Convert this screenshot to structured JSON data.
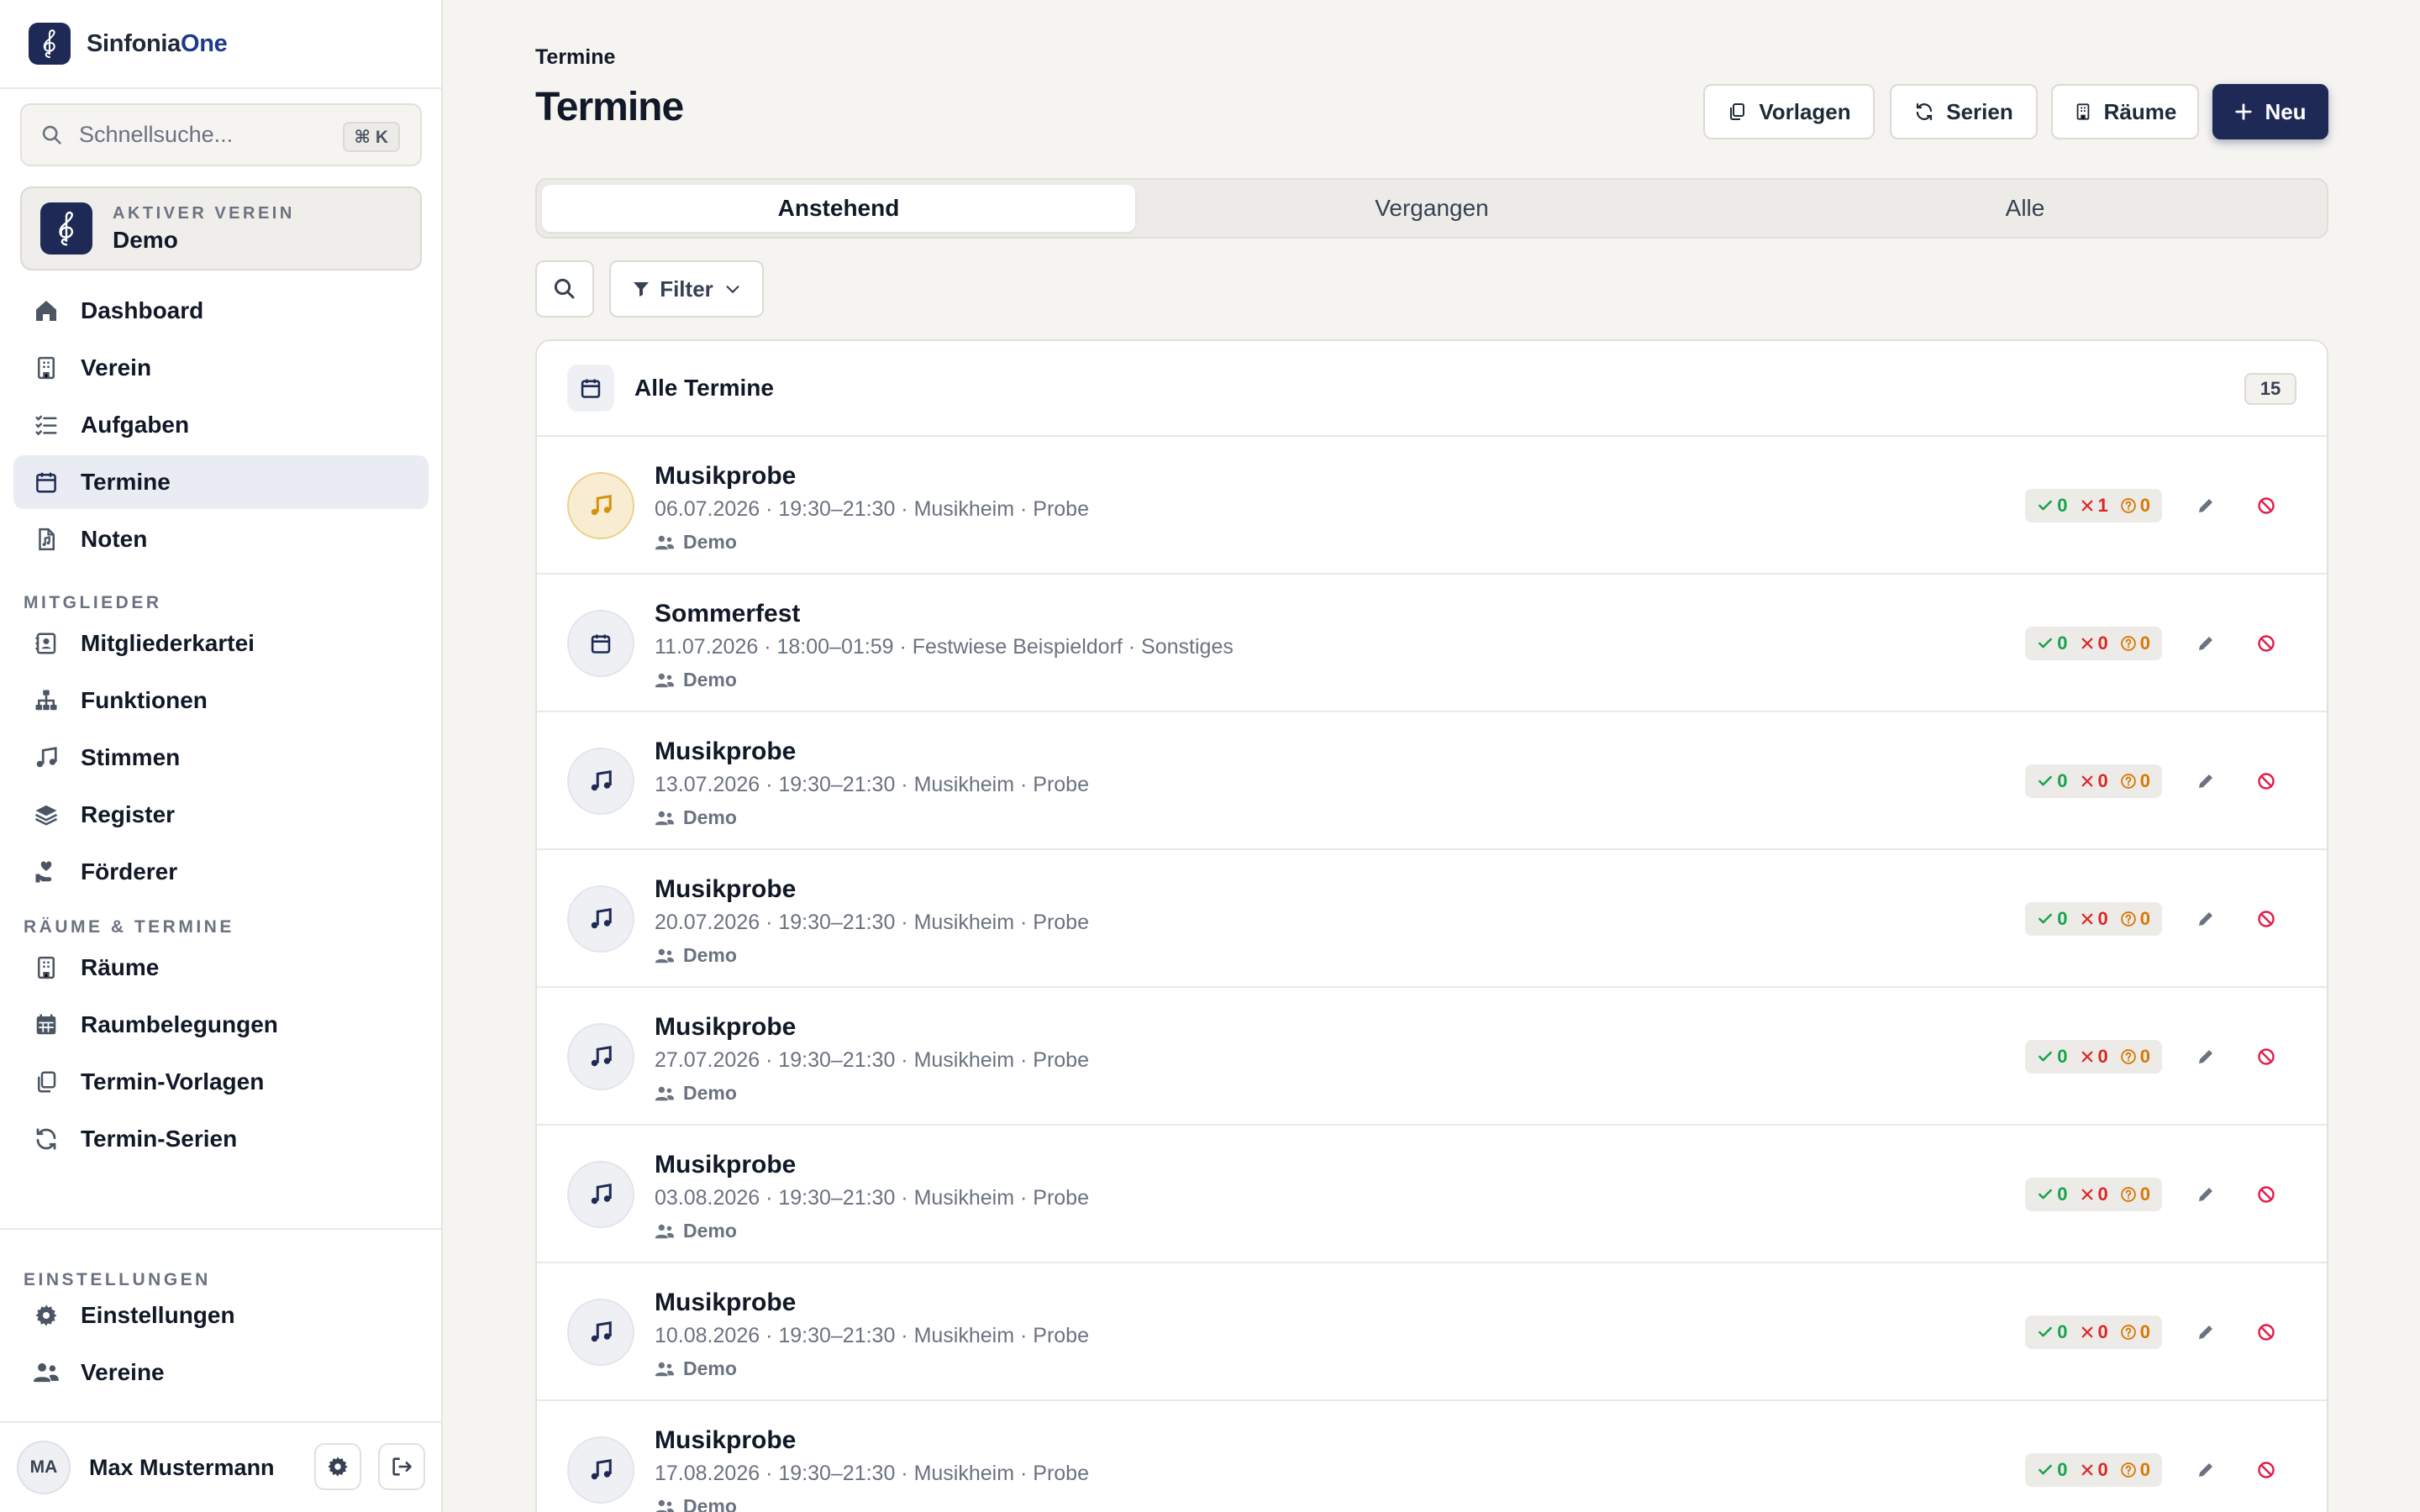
{
  "app": {
    "name_part1": "Sinfonia",
    "name_part2": "One"
  },
  "sidebar": {
    "search": {
      "placeholder": "Schnellsuche...",
      "shortcut": "⌘ K"
    },
    "club": {
      "caption": "AKTIVER VEREIN",
      "name": "Demo"
    },
    "items_main": [
      {
        "label": "Dashboard",
        "icon": "home-icon"
      },
      {
        "label": "Verein",
        "icon": "building-icon"
      },
      {
        "label": "Aufgaben",
        "icon": "tasks-icon"
      },
      {
        "label": "Termine",
        "icon": "calendar-icon",
        "active": true
      },
      {
        "label": "Noten",
        "icon": "sheet-music-file-icon"
      }
    ],
    "section_members": "MITGLIEDER",
    "items_members": [
      {
        "label": "Mitgliederkartei",
        "icon": "contact-card-icon"
      },
      {
        "label": "Funktionen",
        "icon": "hierarchy-icon"
      },
      {
        "label": "Stimmen",
        "icon": "music-note-icon"
      },
      {
        "label": "Register",
        "icon": "layers-icon"
      },
      {
        "label": "Förderer",
        "icon": "hand-heart-icon"
      }
    ],
    "section_rooms": "RÄUME & TERMINE",
    "items_rooms": [
      {
        "label": "Räume",
        "icon": "building-icon"
      },
      {
        "label": "Raumbelegungen",
        "icon": "calendar-grid-icon"
      },
      {
        "label": "Termin-Vorlagen",
        "icon": "copy-icon"
      },
      {
        "label": "Termin-Serien",
        "icon": "refresh-icon"
      }
    ],
    "section_settings": "EINSTELLUNGEN",
    "items_settings": [
      {
        "label": "Einstellungen",
        "icon": "gear-icon"
      },
      {
        "label": "Vereine",
        "icon": "users-icon"
      }
    ],
    "user": {
      "initials": "MA",
      "name": "Max Mustermann"
    }
  },
  "header": {
    "breadcrumb": "Termine",
    "title": "Termine",
    "buttons": {
      "templates": "Vorlagen",
      "series": "Serien",
      "rooms": "Räume",
      "new": "Neu"
    }
  },
  "tabs": [
    {
      "label": "Anstehend",
      "active": true
    },
    {
      "label": "Vergangen"
    },
    {
      "label": "Alle"
    }
  ],
  "filter": {
    "label": "Filter"
  },
  "list": {
    "title": "Alle Termine",
    "count": "15",
    "rows": [
      {
        "title": "Musikprobe",
        "meta": "06.07.2026 · 19:30–21:30 · Musikheim · Probe",
        "org": "Demo",
        "icon": "music-note-icon",
        "highlight": true,
        "yes": "0",
        "no": "1",
        "maybe": "0"
      },
      {
        "title": "Sommerfest",
        "meta": "11.07.2026 · 18:00–01:59 · Festwiese Beispieldorf · Sonstiges",
        "org": "Demo",
        "icon": "calendar-icon",
        "highlight": false,
        "yes": "0",
        "no": "0",
        "maybe": "0"
      },
      {
        "title": "Musikprobe",
        "meta": "13.07.2026 · 19:30–21:30 · Musikheim · Probe",
        "org": "Demo",
        "icon": "music-note-icon",
        "highlight": false,
        "yes": "0",
        "no": "0",
        "maybe": "0"
      },
      {
        "title": "Musikprobe",
        "meta": "20.07.2026 · 19:30–21:30 · Musikheim · Probe",
        "org": "Demo",
        "icon": "music-note-icon",
        "highlight": false,
        "yes": "0",
        "no": "0",
        "maybe": "0"
      },
      {
        "title": "Musikprobe",
        "meta": "27.07.2026 · 19:30–21:30 · Musikheim · Probe",
        "org": "Demo",
        "icon": "music-note-icon",
        "highlight": false,
        "yes": "0",
        "no": "0",
        "maybe": "0"
      },
      {
        "title": "Musikprobe",
        "meta": "03.08.2026 · 19:30–21:30 · Musikheim · Probe",
        "org": "Demo",
        "icon": "music-note-icon",
        "highlight": false,
        "yes": "0",
        "no": "0",
        "maybe": "0"
      },
      {
        "title": "Musikprobe",
        "meta": "10.08.2026 · 19:30–21:30 · Musikheim · Probe",
        "org": "Demo",
        "icon": "music-note-icon",
        "highlight": false,
        "yes": "0",
        "no": "0",
        "maybe": "0"
      },
      {
        "title": "Musikprobe",
        "meta": "17.08.2026 · 19:30–21:30 · Musikheim · Probe",
        "org": "Demo",
        "icon": "music-note-icon",
        "highlight": false,
        "yes": "0",
        "no": "0",
        "maybe": "0"
      }
    ]
  },
  "colors": {
    "primary": "#1e2a55",
    "background": "#f5f4f1",
    "yes": "#16a34a",
    "no": "#dc2626",
    "maybe": "#d97706",
    "highlight": "#d4920b"
  }
}
